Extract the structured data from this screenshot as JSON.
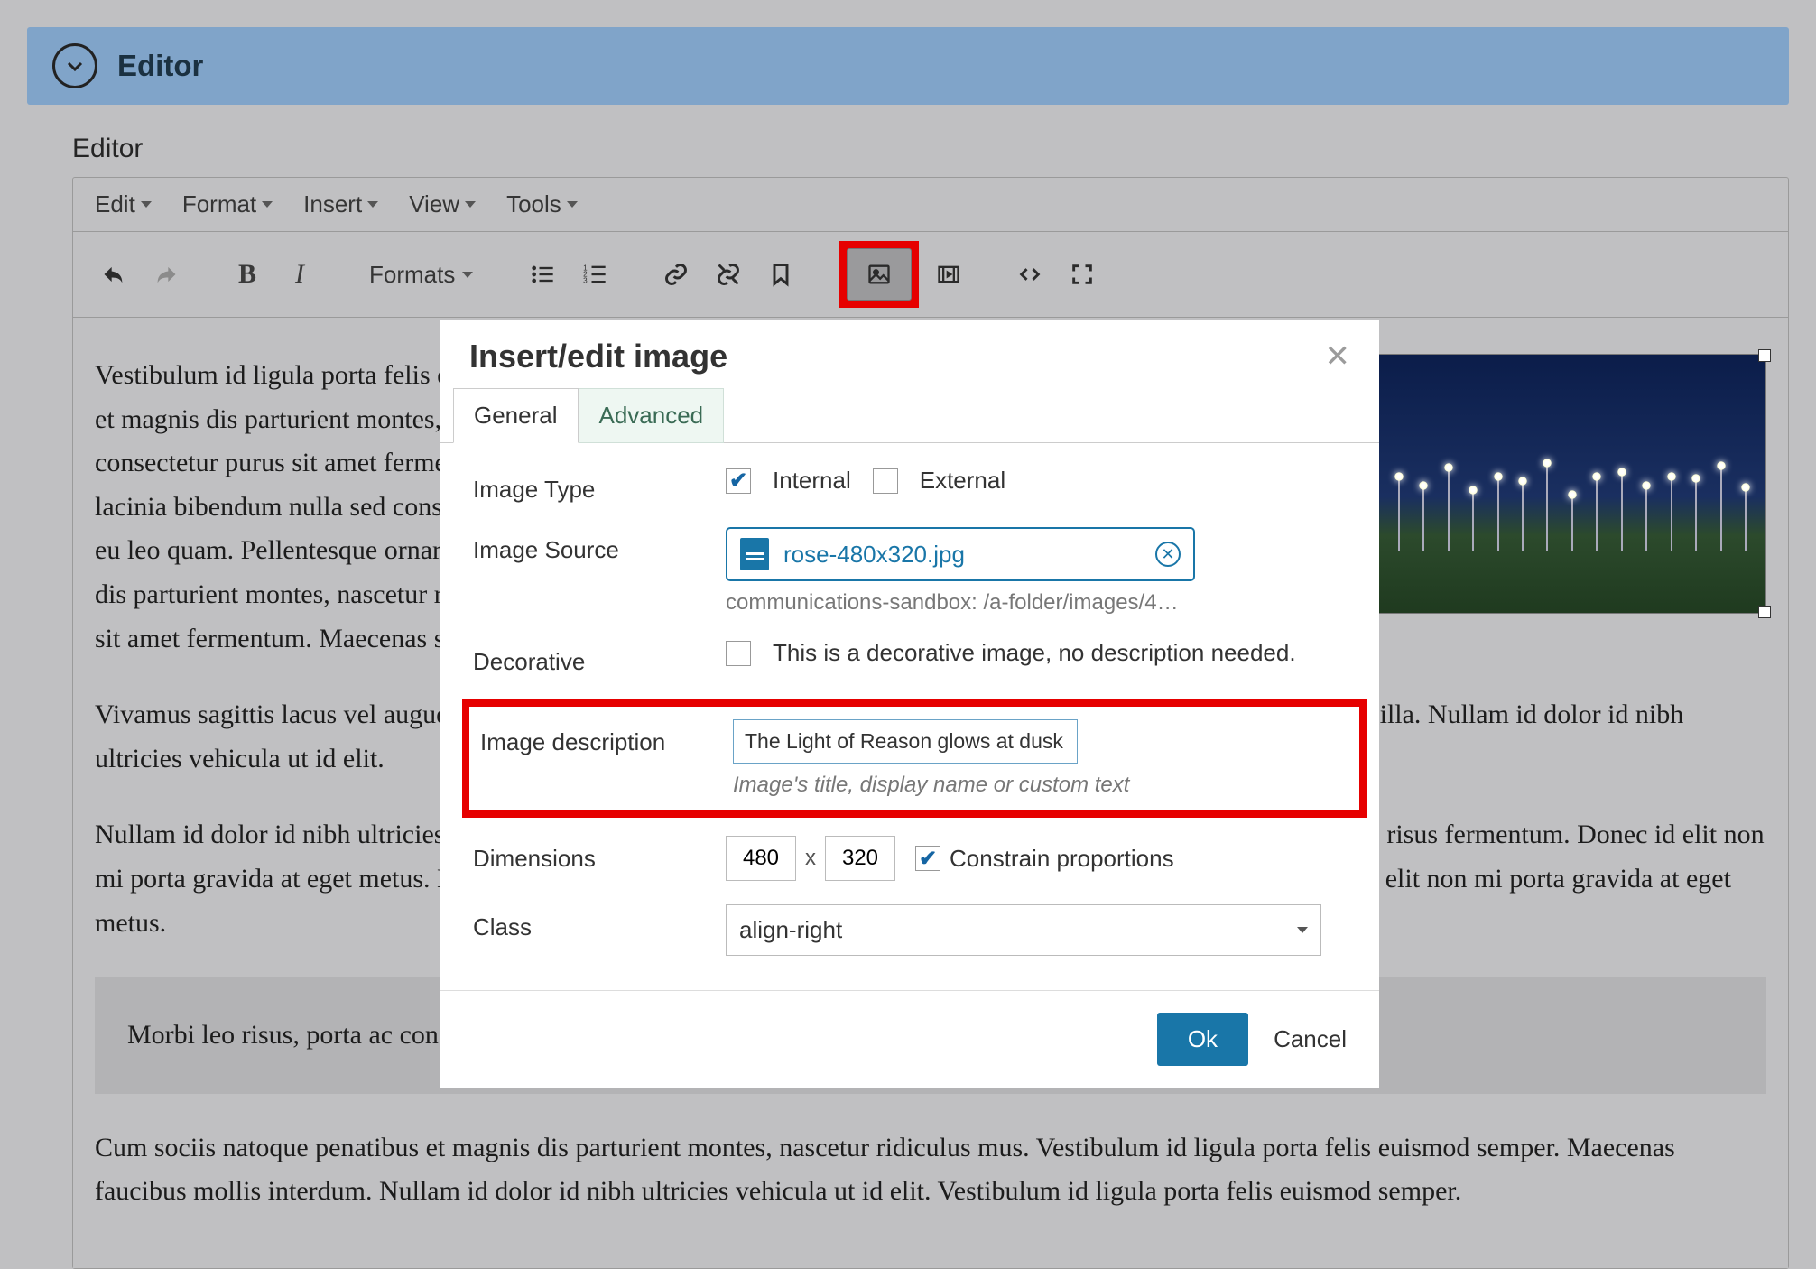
{
  "header": {
    "title": "Editor"
  },
  "section_label": "Editor",
  "menu": {
    "edit": "Edit",
    "format": "Format",
    "insert": "Insert",
    "view": "View",
    "tools": "Tools"
  },
  "toolbar": {
    "formats": "Formats"
  },
  "content": {
    "p1": "Vestibulum id ligula porta felis euismod semper. Maecenas faucibus mollis interdum. Cum sociis natoque penatibus et magnis dis parturient montes, nascetur ridiculus mus. Sed posuere consectetur est at lobortis. Cras mattis consectetur purus sit amet fermentum. Maecenas sed diam eget risus varius blandit sit amet non magna. Aenean lacinia bibendum nulla sed consectetur. Integer posuere erat a ante venenatis dapibus posuere velit aliquet. Aenean eu leo quam. Pellentesque ornare sem lacinia quam venenatis vestibulum. Cum sociis natoque penatibus et magnis dis parturient montes, nascetur ridiculus mus. Sed posuere consectetur est at lobortis. Cras mattis consectetur purus sit amet fermentum. Maecenas sed diam eget risus varius blandit sit amet non metus auctor fringilla.",
    "p2": "Vivamus sagittis lacus vel augue laoreet rutrum faucibus dolor auctor. Donec ullamcorper nulla non metus auctor fringilla. Nullam id dolor id nibh ultricies vehicula ut id elit.",
    "p3": "Nullam id dolor id nibh ultricies vehicula ut id elit. Donec id elit non mi porta gravida at eget consectetur. Nullam quis risus fermentum. Donec id elit non mi porta gravida at eget metus. Nullam quis risus eget urna mollis penatibus et magnis dis parturient montes. Donec id elit non mi porta gravida at eget metus.",
    "quote": "Morbi leo risus, porta ac consectetur ac, vestibulum at eros. Cras mattis consectetur purus sit amet fermentum.",
    "p4": "Cum sociis natoque penatibus et magnis dis parturient montes, nascetur ridiculus mus. Vestibulum id ligula porta felis euismod semper. Maecenas faucibus mollis interdum. Nullam id dolor id nibh ultricies vehicula ut id elit. Vestibulum id ligula porta felis euismod semper."
  },
  "modal": {
    "title": "Insert/edit image",
    "tabs": {
      "general": "General",
      "advanced": "Advanced"
    },
    "labels": {
      "image_type": "Image Type",
      "internal": "Internal",
      "external": "External",
      "image_source": "Image Source",
      "source_file": "rose-480x320.jpg",
      "source_path": "communications-sandbox: /a-folder/images/4…",
      "decorative": "Decorative",
      "decorative_text": "This is a decorative image, no description needed.",
      "image_description": "Image description",
      "description_value": "The Light of Reason glows at dusk",
      "description_help": "Image's title, display name or custom text",
      "dimensions": "Dimensions",
      "width": "480",
      "height": "320",
      "constrain": "Constrain proportions",
      "class": "Class",
      "class_value": "align-right"
    },
    "buttons": {
      "ok": "Ok",
      "cancel": "Cancel"
    },
    "dim_sep": "x"
  }
}
